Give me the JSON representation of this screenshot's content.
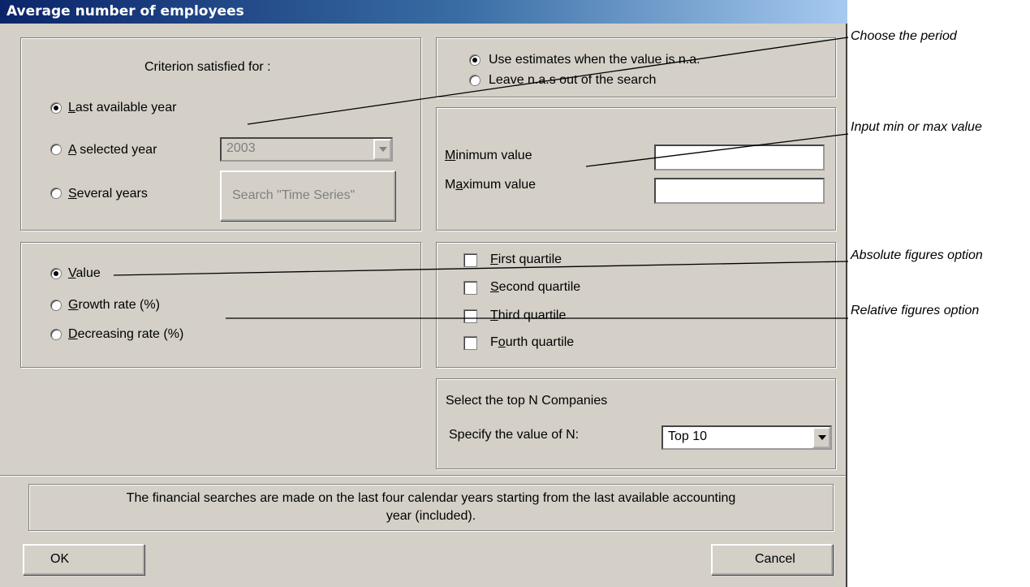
{
  "dialog": {
    "title": "Average number of employees"
  },
  "criterion": {
    "header": "Criterion satisfied for :",
    "options": [
      {
        "pre": "",
        "key": "L",
        "rest": "ast available year",
        "selected": true
      },
      {
        "pre": "",
        "key": "A",
        "rest": " selected year",
        "selected": false
      },
      {
        "pre": "",
        "key": "S",
        "rest": "everal years",
        "selected": false
      }
    ],
    "year_value": "2003",
    "time_series_button": "Search \"Time Series\""
  },
  "estimates": {
    "options": [
      {
        "label": "Use estimates when the value is n.a.",
        "selected": true
      },
      {
        "label": "Leave n.a.s out of the search",
        "selected": false
      }
    ]
  },
  "range": {
    "min": {
      "pre": "",
      "key": "M",
      "rest": "inimum value",
      "value": ""
    },
    "max": {
      "pre": "M",
      "key": "a",
      "rest": "ximum value",
      "value": ""
    }
  },
  "measure": {
    "options": [
      {
        "pre": "",
        "key": "V",
        "rest": "alue",
        "selected": true
      },
      {
        "pre": "",
        "key": "G",
        "rest": "rowth rate (%)",
        "selected": false
      },
      {
        "pre": "",
        "key": "D",
        "rest": "ecreasing rate (%)",
        "selected": false
      }
    ]
  },
  "quartiles": [
    {
      "pre": "",
      "key": "F",
      "rest": "irst quartile",
      "checked": false
    },
    {
      "pre": "",
      "key": "S",
      "rest": "econd quartile",
      "checked": false
    },
    {
      "pre": "",
      "key": "T",
      "rest": "hird quartile",
      "checked": false
    },
    {
      "pre": "F",
      "key": "o",
      "rest": "urth quartile",
      "checked": false
    }
  ],
  "topn": {
    "header": "Select the top N Companies",
    "label": "Specify the value of N:",
    "value": "Top 10"
  },
  "info": {
    "line1": "The financial searches are made on the last four calendar years starting from the last available accounting",
    "line2": "year (included)."
  },
  "buttons": {
    "ok": "OK",
    "cancel": "Cancel"
  },
  "annotations": {
    "period": "Choose the period",
    "minmax": "Input min or max value",
    "absolute": "Absolute figures option",
    "relative": "Relative figures  option"
  },
  "colors": {
    "dialog_bg": "#d4d0c8",
    "title_start": "#0a246a",
    "title_end": "#a6caf0"
  }
}
